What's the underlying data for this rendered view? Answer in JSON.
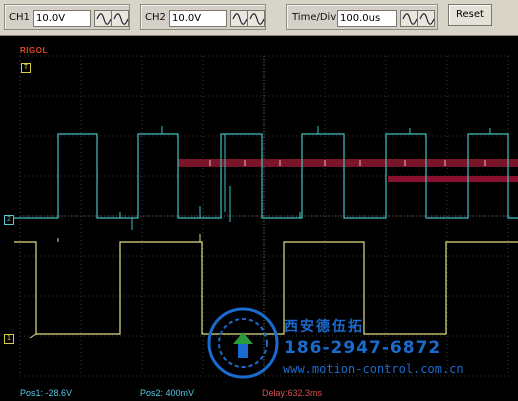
{
  "toolbar": {
    "ch1": {
      "label": "CH1",
      "value": "10.0V"
    },
    "ch2": {
      "label": "CH2",
      "value": "10.0V"
    },
    "timediv": {
      "label": "Time/Div",
      "value": "100.0us"
    },
    "reset_label": "Reset"
  },
  "scope": {
    "brand": "RIGOL",
    "markers": {
      "top": "T",
      "ch2": "2",
      "ch1": "1"
    },
    "status": {
      "pos1": "Pos1:  -28.6V",
      "pos2": "Pos2:  400mV",
      "delay": "Delay:632.3ms"
    },
    "colors": {
      "ch1_trace": "#e0e080",
      "ch2_trace": "#40c0c0",
      "grid": "#3c3c3c",
      "decode_bar": "#7a1428"
    }
  },
  "watermark": {
    "company": "西安德伍拓",
    "phone": "186-2947-6872",
    "url": "www.motion-control.com.cn"
  }
}
